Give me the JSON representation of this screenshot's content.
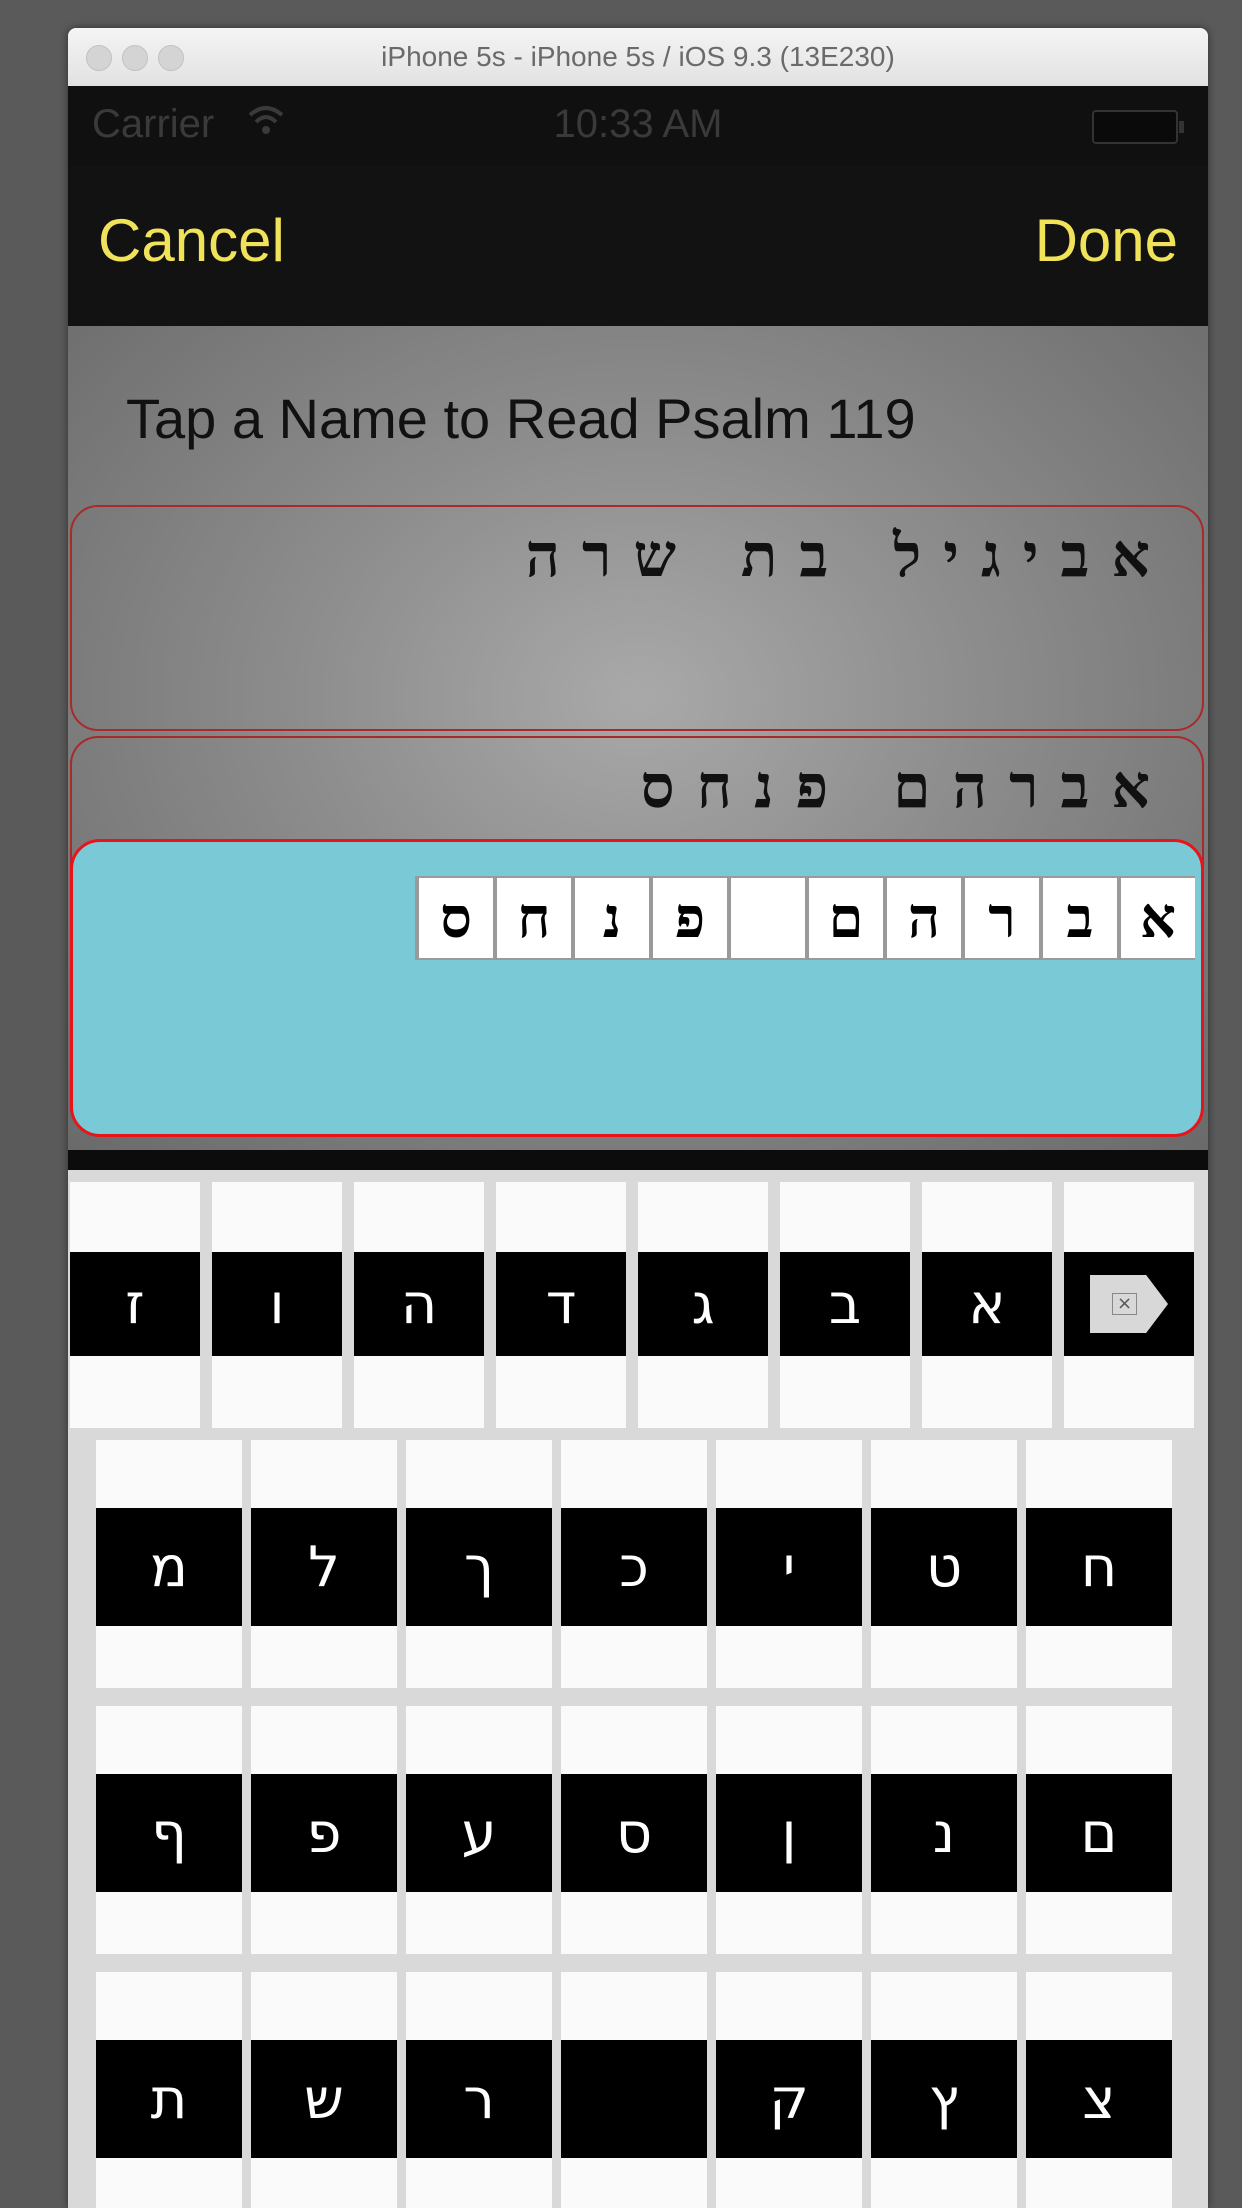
{
  "window": {
    "title": "iPhone 5s - iPhone 5s / iOS 9.3 (13E230)"
  },
  "status_bar": {
    "carrier": "Carrier",
    "wifi_icon": "wifi-icon",
    "time": "10:33 AM",
    "battery_icon": "battery-icon"
  },
  "nav": {
    "cancel_label": "Cancel",
    "done_label": "Done"
  },
  "prompt": "Tap a Name to Read Psalm 119",
  "names": [
    {
      "text": "אביגיל בת שרה"
    },
    {
      "text": "אברהם פנחס"
    }
  ],
  "selected_name": {
    "tiles": [
      "א",
      "ב",
      "ר",
      "ה",
      "ם",
      " ",
      "פ",
      "נ",
      "ח",
      "ס"
    ]
  },
  "keyboard": {
    "row1": [
      "⌫",
      "א",
      "ב",
      "ג",
      "ד",
      "ה",
      "ו",
      "ז"
    ],
    "row2": [
      "ח",
      "ט",
      "י",
      "כ",
      "ך",
      "ל",
      "מ"
    ],
    "row3": [
      "ם",
      "נ",
      "ן",
      "ס",
      "ע",
      "פ",
      "ף"
    ],
    "row4": [
      "צ",
      "ץ",
      "ק",
      " ",
      "ר",
      "ש",
      "ת"
    ],
    "backspace_icon": "backspace-icon"
  },
  "colors": {
    "nav_text": "#f0e35a",
    "selected_bg": "#79c9d6",
    "selected_border": "#e8141a"
  }
}
